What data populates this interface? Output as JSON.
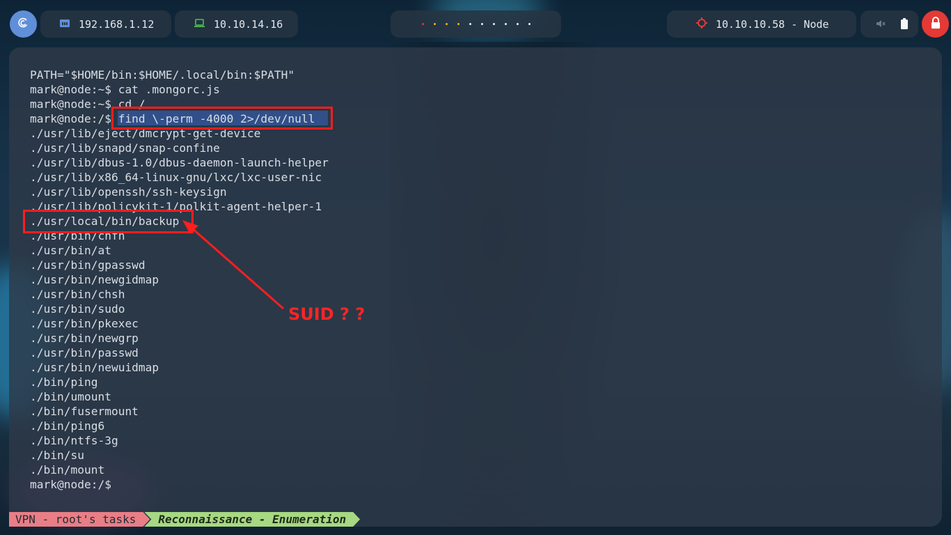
{
  "topbar": {
    "local_ip": "192.168.1.12",
    "vpn_ip": "10.10.14.16",
    "target": "10.10.10.58 - Node",
    "workspace_dot_colors": [
      "#e53935",
      "#f4b400",
      "#f4b400",
      "#f4b400",
      "#e9eef4",
      "#e9eef4",
      "#e9eef4",
      "#e9eef4",
      "#e9eef4",
      "#e9eef4"
    ],
    "icons": {
      "launcher": "debian-icon",
      "local": "ethernet-icon",
      "vpn": "laptop-icon",
      "target": "crosshair-icon",
      "mute": "speaker-muted-icon",
      "battery": "battery-icon",
      "power": "lock-icon"
    }
  },
  "terminal": {
    "lines": [
      "PATH=\"$HOME/bin:$HOME/.local/bin:$PATH\"",
      "mark@node:~$ cat .mongorc.js",
      "mark@node:~$ cd /",
      "mark@node:/$ find \\-perm -4000 2>/dev/null",
      "./usr/lib/eject/dmcrypt-get-device",
      "./usr/lib/snapd/snap-confine",
      "./usr/lib/dbus-1.0/dbus-daemon-launch-helper",
      "./usr/lib/x86_64-linux-gnu/lxc/lxc-user-nic",
      "./usr/lib/openssh/ssh-keysign",
      "./usr/lib/policykit-1/polkit-agent-helper-1",
      "./usr/local/bin/backup",
      "./usr/bin/chfn",
      "./usr/bin/at",
      "./usr/bin/gpasswd",
      "./usr/bin/newgidmap",
      "./usr/bin/chsh",
      "./usr/bin/sudo",
      "./usr/bin/pkexec",
      "./usr/bin/newgrp",
      "./usr/bin/passwd",
      "./usr/bin/newuidmap",
      "./bin/ping",
      "./bin/umount",
      "./bin/fusermount",
      "./bin/ping6",
      "./bin/ntfs-3g",
      "./bin/su",
      "./bin/mount",
      "mark@node:/$"
    ]
  },
  "annotation": {
    "text": "SUID ? ?",
    "color": "#ff2424"
  },
  "statusbar": {
    "session": "VPN - root's tasks",
    "window": "Reconnaissance - Enumeration",
    "colors": {
      "session": "#e97e86",
      "window": "#a7d882"
    }
  }
}
